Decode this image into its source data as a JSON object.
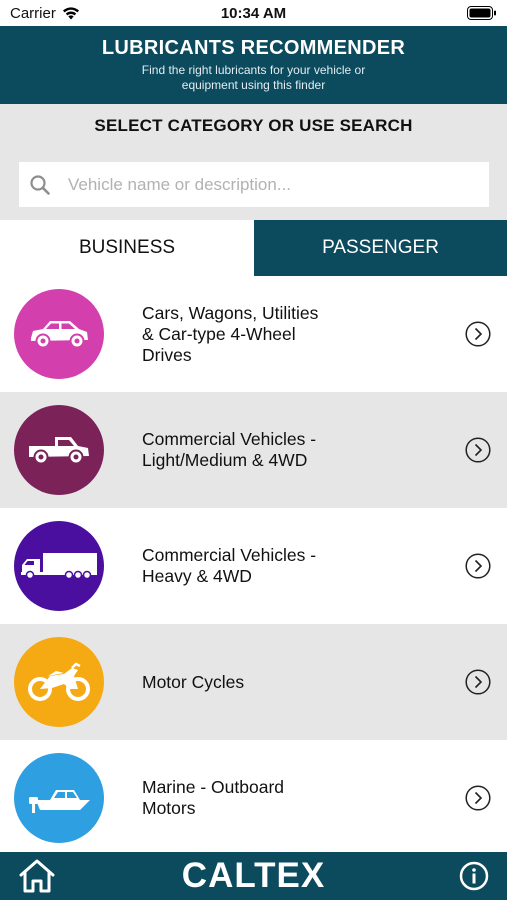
{
  "status_bar": {
    "carrier": "Carrier",
    "time": "10:34 AM"
  },
  "header": {
    "title": "LUBRICANTS RECOMMENDER",
    "subtitle": "Find the right lubricants for your vehicle or equipment using this finder"
  },
  "category_prompt": "SELECT CATEGORY OR USE SEARCH",
  "search": {
    "placeholder": "Vehicle name or description...",
    "value": ""
  },
  "tabs": [
    {
      "label": "BUSINESS",
      "selected": true
    },
    {
      "label": "PASSENGER",
      "selected": false
    }
  ],
  "categories": [
    {
      "label": "Cars, Wagons, Utilities & Car-type 4-Wheel Drives",
      "icon": "car-icon",
      "color": "#d43fae"
    },
    {
      "label": "Commercial Vehicles - Light/Medium & 4WD",
      "icon": "pickup-truck-icon",
      "color": "#7b2359"
    },
    {
      "label": "Commercial Vehicles - Heavy & 4WD",
      "icon": "semi-truck-icon",
      "color": "#4a0f9e"
    },
    {
      "label": "Motor Cycles",
      "icon": "motorcycle-icon",
      "color": "#f5aa14"
    },
    {
      "label": "Marine - Outboard Motors",
      "icon": "boat-icon",
      "color": "#2e9fe0"
    }
  ],
  "bottom_bar": {
    "brand": "CALTEX",
    "home_icon": "home-icon",
    "info_icon": "info-icon"
  },
  "colors": {
    "primary": "#0c4a5e",
    "alt_row": "#e6e6e6"
  }
}
